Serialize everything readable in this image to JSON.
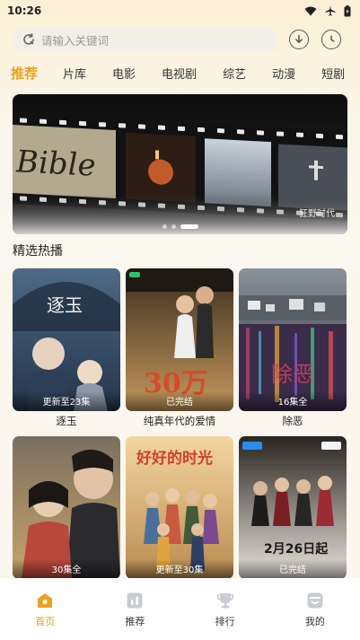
{
  "status_bar": {
    "time": "10:26"
  },
  "search": {
    "placeholder": "请输入关键词"
  },
  "tabs": [
    {
      "label": "推荐",
      "active": true
    },
    {
      "label": "片库"
    },
    {
      "label": "电影"
    },
    {
      "label": "电视剧"
    },
    {
      "label": "综艺"
    },
    {
      "label": "动漫"
    },
    {
      "label": "短剧"
    }
  ],
  "banner": {
    "caption": "狂野时代",
    "slides": 3,
    "active_slide": 3,
    "poster_text": "Bible"
  },
  "section": {
    "title": "精选热播"
  },
  "cards": [
    {
      "title": "逐玉",
      "badge": "更新至23集",
      "poster_text": "逐玉"
    },
    {
      "title": "纯真年代的爱情",
      "badge": "已完结",
      "poster_text": "30万"
    },
    {
      "title": "除恶",
      "badge": "16集全",
      "poster_text": "除恶"
    },
    {
      "title": "",
      "badge": "30集全",
      "poster_text": ""
    },
    {
      "title": "",
      "badge": "更新至30集",
      "poster_text": "好好的时光"
    },
    {
      "title": "",
      "badge": "已完结",
      "poster_text": "2月26日起"
    }
  ],
  "bottom_nav": [
    {
      "label": "首页",
      "icon": "home-icon",
      "active": true
    },
    {
      "label": "推荐",
      "icon": "chart-icon"
    },
    {
      "label": "排行",
      "icon": "trophy-icon"
    },
    {
      "label": "我的",
      "icon": "profile-icon"
    }
  ],
  "colors": {
    "accent": "#f0a11b",
    "background": "#fbf7ee"
  }
}
